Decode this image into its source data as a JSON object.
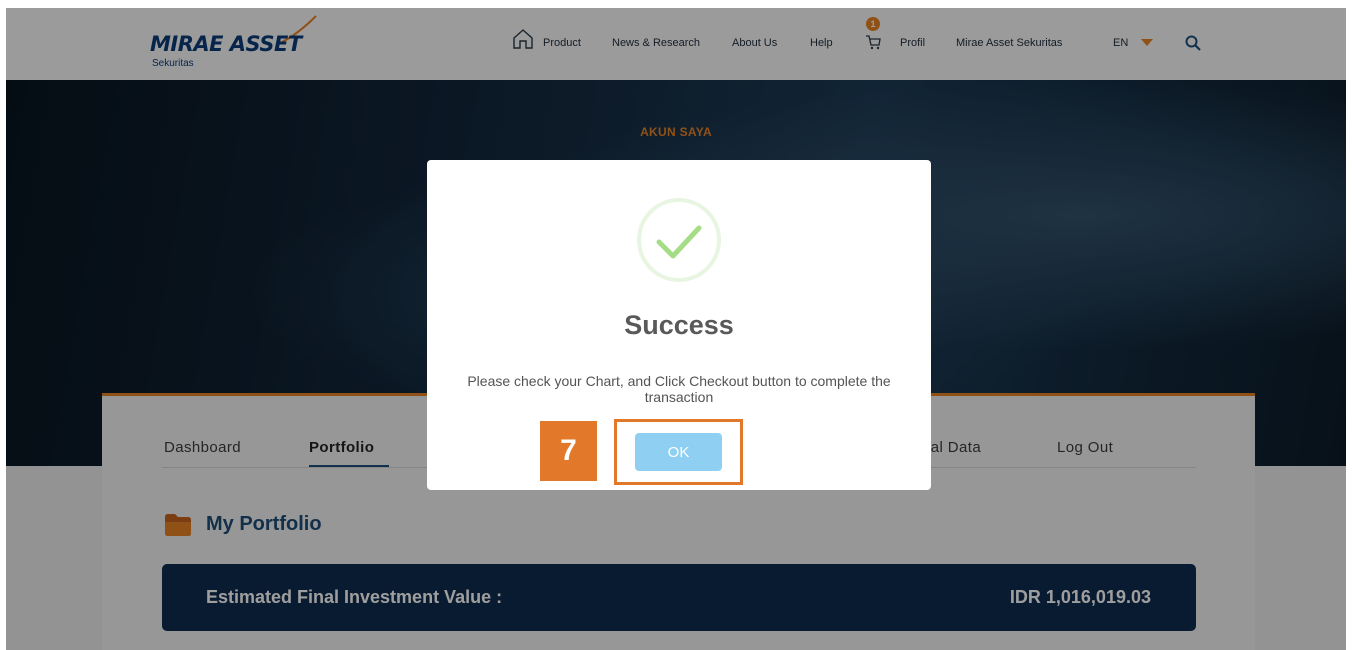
{
  "header": {
    "logo_text": "MIRAE ASSET",
    "logo_subtext": "Sekuritas",
    "nav": {
      "product": "Product",
      "news_research": "News & Research",
      "about_us": "About Us",
      "help": "Help",
      "cart_count": "1",
      "profil": "Profil",
      "company": "Mirae Asset Sekuritas",
      "language": "EN"
    }
  },
  "hero": {
    "title": "AKUN SAYA"
  },
  "tabs": {
    "dashboard": "Dashboard",
    "portfolio": "Portfolio",
    "personal_data_partial": "nal Data",
    "logout": "Log Out"
  },
  "portfolio": {
    "title": "My Portfolio",
    "estimate_label": "Estimated Final Investment Value :",
    "estimate_value": "IDR 1,016,019.03"
  },
  "modal": {
    "title": "Success",
    "message": "Please check your Chart, and Click Checkout button to complete the transaction",
    "ok_label": "OK"
  },
  "annotation": {
    "step_number": "7"
  },
  "colors": {
    "accent_orange": "#e98425",
    "brand_navy": "#0c3d78",
    "value_bar": "#102d4e",
    "ok_button": "#8fd0f2",
    "success_green": "#a5dc86"
  }
}
